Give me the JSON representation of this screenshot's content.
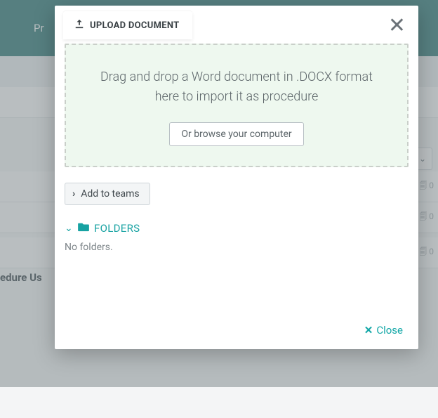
{
  "bg": {
    "nav_partial": "Pr",
    "section_partial": "edure Us",
    "row_badge": "0"
  },
  "modal": {
    "tab_label": "UPLOAD DOCUMENT",
    "drop_text": "Drag and drop a Word document in .DOCX format here to import it as procedure",
    "browse_label": "Or browse your computer",
    "teams_label": "Add to teams",
    "folders_label": "FOLDERS",
    "no_folders": "No folders.",
    "close_label": "Close"
  }
}
